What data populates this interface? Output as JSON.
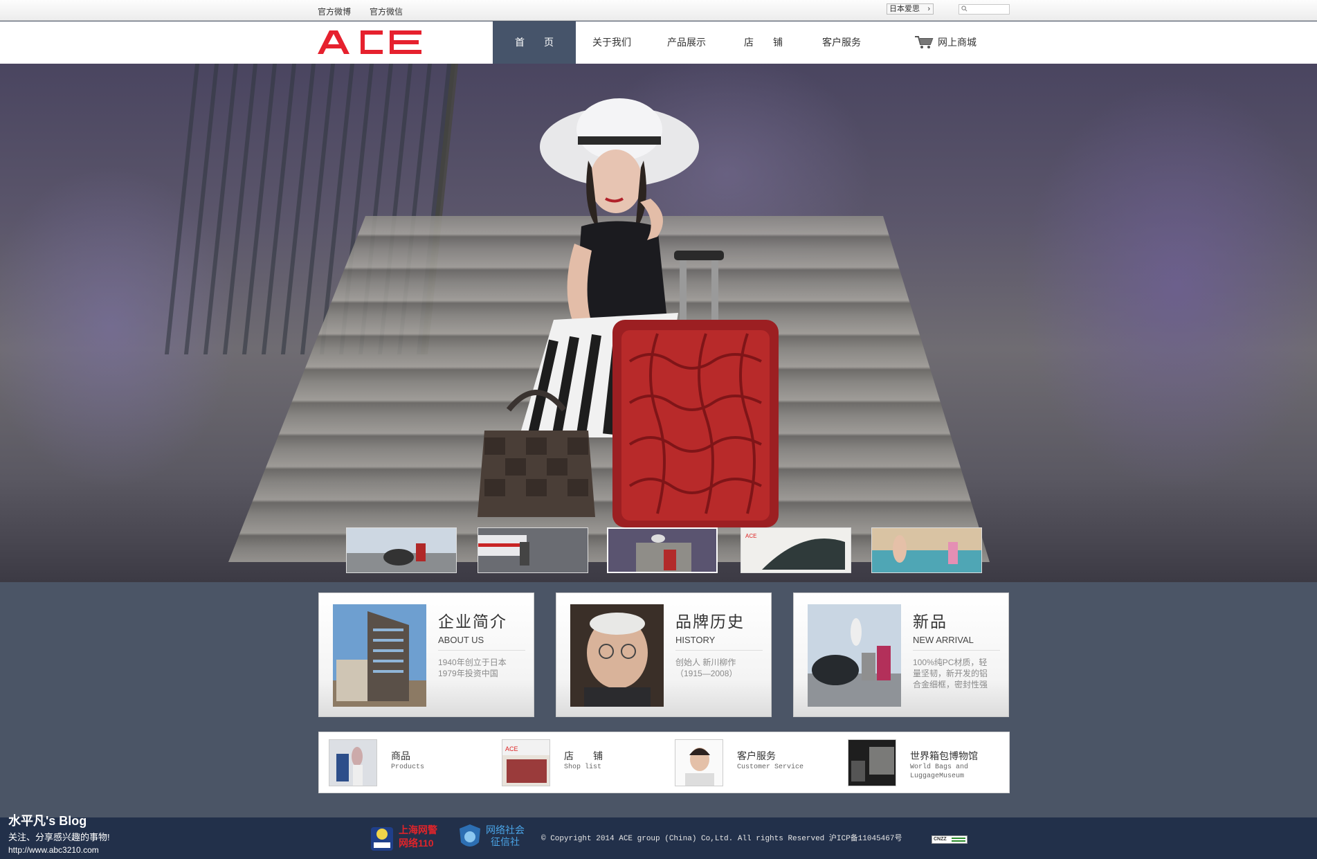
{
  "topbar": {
    "links": [
      "官方微博",
      "官方微信"
    ],
    "language": "日本爱思",
    "search_placeholder": ""
  },
  "brand": {
    "logo_text": "ACE",
    "logo_color": "#e6212e"
  },
  "nav": {
    "items": [
      "首　　页",
      "关于我们",
      "产品展示",
      "店　　铺",
      "客户服务"
    ],
    "active_index": 0,
    "shop": "网上商城"
  },
  "colors": {
    "nav_active_bg": "#46546a",
    "footer_bg": "#22304a",
    "page_bg": "#4b5566"
  },
  "hero": {
    "thumbnails_count": 5,
    "active_thumbnail": 2
  },
  "cards": [
    {
      "title": "企业简介",
      "subtitle": "ABOUT US",
      "desc": "1940年创立于日本\n1979年投资中国"
    },
    {
      "title": "品牌历史",
      "subtitle": "HISTORY",
      "desc": "创始人 新川柳作\n（1915—2008）"
    },
    {
      "title": "新品",
      "subtitle": "NEW ARRIVAL",
      "desc": "100%纯PC材质，轻量坚韧，新开发的铝合金细框，密封性强"
    }
  ],
  "quick_links": [
    {
      "title": "商品",
      "sub": "Products"
    },
    {
      "title": "店　　铺",
      "sub": "Shop list"
    },
    {
      "title": "客户服务",
      "sub": "Customer Service"
    },
    {
      "title": "世界箱包博物馆",
      "sub": "World Bags and LuggageMuseum"
    }
  ],
  "footer": {
    "badge_police_line1": "上海网警",
    "badge_police_line2": "网络110",
    "badge_credit_line1": "网络社会",
    "badge_credit_line2": "征信社",
    "copyright": "© Copyright 2014 ACE group (China) Co,Ltd. All rights Reserved 沪ICP备11045467号",
    "cnzz": "CNZZ"
  },
  "watermark": {
    "title": "水平凡's Blog",
    "tagline": "关注、分享感兴趣的事物!",
    "url": "http://www.abc3210.com"
  }
}
